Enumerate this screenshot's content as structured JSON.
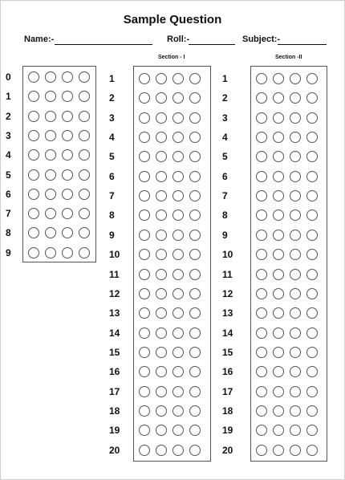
{
  "title": "Sample Question",
  "fields": {
    "name_label": "Name:-",
    "roll_label": "Roll:-",
    "subject_label": "Subject:-"
  },
  "roll_panel": {
    "digits": [
      "0",
      "1",
      "2",
      "3",
      "4",
      "5",
      "6",
      "7",
      "8",
      "9"
    ],
    "bubbles_per_row": 4
  },
  "sections": [
    {
      "title": "Section - I",
      "numbers": [
        "1",
        "2",
        "3",
        "4",
        "5",
        "6",
        "7",
        "8",
        "9",
        "10",
        "11",
        "12",
        "13",
        "14",
        "15",
        "16",
        "17",
        "18",
        "19",
        "20"
      ],
      "bubbles_per_row": 4
    },
    {
      "title": "Section -II",
      "numbers": [
        "1",
        "2",
        "3",
        "4",
        "5",
        "6",
        "7",
        "8",
        "9",
        "10",
        "11",
        "12",
        "13",
        "14",
        "15",
        "16",
        "17",
        "18",
        "19",
        "20"
      ],
      "bubbles_per_row": 4
    }
  ]
}
